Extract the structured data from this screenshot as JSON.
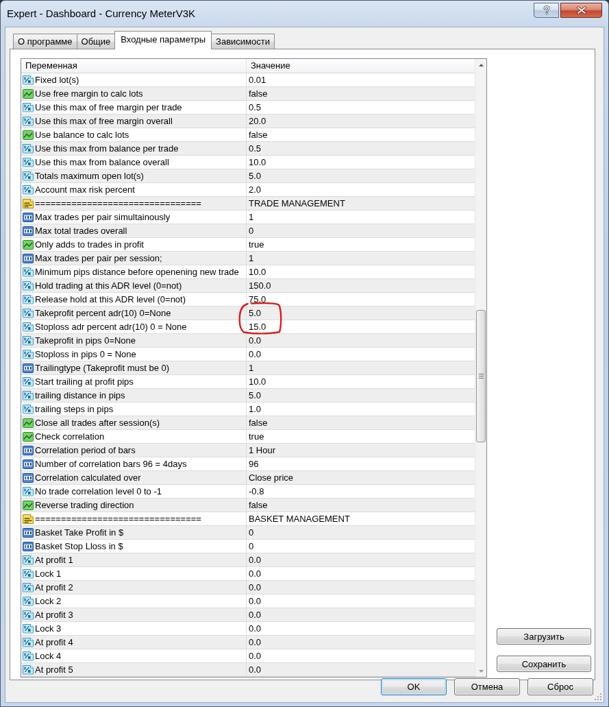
{
  "window": {
    "title": "Expert - Dashboard - Currency MeterV3K"
  },
  "tabs": [
    {
      "label": "О программе",
      "selected": false
    },
    {
      "label": "Общие",
      "selected": false
    },
    {
      "label": "Входные параметры",
      "selected": true
    },
    {
      "label": "Зависимости",
      "selected": false
    }
  ],
  "table": {
    "columns": [
      "Переменная",
      "Значение"
    ],
    "rows": [
      {
        "kind": "double",
        "name": "Fixed lot(s)",
        "value": "0.01",
        "circled": false
      },
      {
        "kind": "bool",
        "name": "Use free margin to calc lots",
        "value": "false",
        "circled": false
      },
      {
        "kind": "double",
        "name": "Use this max of free margin per trade",
        "value": "0.5",
        "circled": false
      },
      {
        "kind": "double",
        "name": "Use this max of free margin overall",
        "value": "20.0",
        "circled": false
      },
      {
        "kind": "bool",
        "name": "Use balance to calc lots",
        "value": "false",
        "circled": false
      },
      {
        "kind": "double",
        "name": "Use this max from balance per trade",
        "value": "0.5",
        "circled": false
      },
      {
        "kind": "double",
        "name": "Use this max from balance overall",
        "value": "10.0",
        "circled": false
      },
      {
        "kind": "double",
        "name": "Totals maximum open lot(s)",
        "value": "5.0",
        "circled": false
      },
      {
        "kind": "double",
        "name": "Account max risk percent",
        "value": "2.0",
        "circled": false
      },
      {
        "kind": "string",
        "name": "================================",
        "value": "TRADE MANAGEMENT",
        "circled": false
      },
      {
        "kind": "integer",
        "name": "Max trades per pair simultainously",
        "value": "1",
        "circled": false
      },
      {
        "kind": "integer",
        "name": "Max total trades overall",
        "value": "0",
        "circled": false
      },
      {
        "kind": "bool",
        "name": "Only adds to trades in profit",
        "value": "true",
        "circled": false
      },
      {
        "kind": "integer",
        "name": "Max trades per pair per session;",
        "value": "1",
        "circled": false
      },
      {
        "kind": "double",
        "name": "Minimum pips distance before openening new trade",
        "value": "10.0",
        "circled": false
      },
      {
        "kind": "double",
        "name": "Hold trading at this ADR level (0=not)",
        "value": "150.0",
        "circled": false
      },
      {
        "kind": "double",
        "name": "Release hold at this ADR level (0=not)",
        "value": "75.0",
        "circled": false
      },
      {
        "kind": "double",
        "name": "Takeprofit percent adr(10) 0=None",
        "value": "5.0",
        "circled": true
      },
      {
        "kind": "double",
        "name": "Stoploss adr percent adr(10) 0 = None",
        "value": "15.0",
        "circled": true
      },
      {
        "kind": "double",
        "name": "Takeprofit in pips 0=None",
        "value": "0.0",
        "circled": false
      },
      {
        "kind": "double",
        "name": "Stoploss in pips 0 = None",
        "value": "0.0",
        "circled": false
      },
      {
        "kind": "integer",
        "name": "Trailingtype (Takeprofit must be 0)",
        "value": "1",
        "circled": false
      },
      {
        "kind": "double",
        "name": "Start trailing at profit pips",
        "value": "10.0",
        "circled": false
      },
      {
        "kind": "double",
        "name": "trailing distance in pips",
        "value": "5.0",
        "circled": false
      },
      {
        "kind": "double",
        "name": "trailing steps in pips",
        "value": "1.0",
        "circled": false
      },
      {
        "kind": "bool",
        "name": "Close all trades after session(s)",
        "value": "false",
        "circled": false
      },
      {
        "kind": "bool",
        "name": "Check correlation",
        "value": "true",
        "circled": false
      },
      {
        "kind": "integer",
        "name": "Correlation period of bars",
        "value": "1 Hour",
        "circled": false
      },
      {
        "kind": "integer",
        "name": "Number of correlation bars 96 = 4days",
        "value": "96",
        "circled": false
      },
      {
        "kind": "integer",
        "name": "Correlation calculated over",
        "value": "Close price",
        "circled": false
      },
      {
        "kind": "double",
        "name": "No trade correlation level 0 to -1",
        "value": "-0.8",
        "circled": false
      },
      {
        "kind": "bool",
        "name": "Reverse trading direction",
        "value": "false",
        "circled": false
      },
      {
        "kind": "string",
        "name": "================================",
        "value": "BASKET MANAGEMENT",
        "circled": false
      },
      {
        "kind": "integer",
        "name": "Basket Take Profit in $",
        "value": "0",
        "circled": false
      },
      {
        "kind": "integer",
        "name": "Basket Stop Lloss in $",
        "value": "0",
        "circled": false
      },
      {
        "kind": "double",
        "name": "At profit 1",
        "value": "0.0",
        "circled": false
      },
      {
        "kind": "double",
        "name": "Lock 1",
        "value": "0.0",
        "circled": false
      },
      {
        "kind": "double",
        "name": "At profit 2",
        "value": "0.0",
        "circled": false
      },
      {
        "kind": "double",
        "name": "Lock 2",
        "value": "0.0",
        "circled": false
      },
      {
        "kind": "double",
        "name": "At profit 3",
        "value": "0.0",
        "circled": false
      },
      {
        "kind": "double",
        "name": "Lock 3",
        "value": "0.0",
        "circled": false
      },
      {
        "kind": "double",
        "name": "At profit 4",
        "value": "0.0",
        "circled": false
      },
      {
        "kind": "double",
        "name": "Lock 4",
        "value": "0.0",
        "circled": false
      },
      {
        "kind": "double",
        "name": "At profit 5",
        "value": "0.0",
        "circled": false
      }
    ]
  },
  "side_buttons": [
    "Загрузить",
    "Сохранить"
  ],
  "buttons": [
    {
      "label": "OK",
      "default": true
    },
    {
      "label": "Отмена",
      "default": false
    },
    {
      "label": "Сброс",
      "default": false
    }
  ]
}
